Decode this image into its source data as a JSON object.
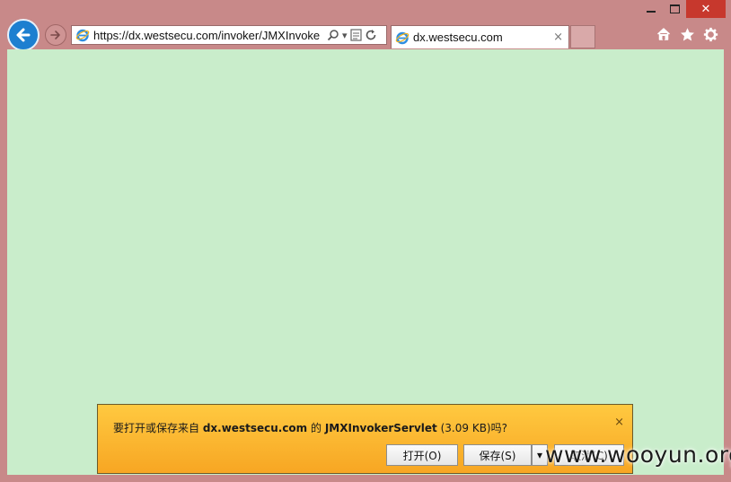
{
  "browser": {
    "address_url": "https://dx.westsecu.com/invoker/JMXInvoke",
    "tab_title": "dx.westsecu.com",
    "tab_close_glyph": "×",
    "icons": {
      "back": "back-arrow-icon",
      "forward": "forward-arrow-icon",
      "search": "search-icon",
      "compat": "compatibility-view-icon",
      "refresh": "refresh-icon",
      "home": "home-icon",
      "favorites": "star-icon",
      "settings": "gear-icon"
    }
  },
  "window_controls": {
    "close_glyph": "✕"
  },
  "colors": {
    "frame": "#c88989",
    "content_bg": "#c9edcb",
    "notify_bg": "#ffc940",
    "back_button": "#1d7fd0",
    "close_button": "#c7382d"
  },
  "download_bar": {
    "prefix": "要打开或保存来自 ",
    "site": "dx.westsecu.com",
    "middle": " 的 ",
    "filename": "JMXInvokerServlet",
    "suffix": " (3.09 KB)吗?",
    "close_glyph": "×",
    "open_label": "打开(O)",
    "save_label": "保存(S)",
    "save_dropdown_glyph": "▾",
    "cancel_label": "取消(C)"
  },
  "watermark": "www.wooyun.org"
}
